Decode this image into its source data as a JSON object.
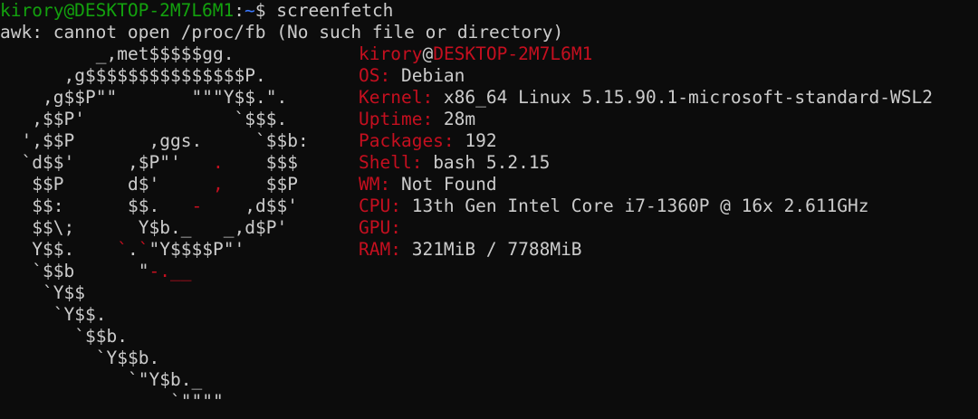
{
  "prompt": {
    "user_host": "kirory@DESKTOP-2M7L6M1",
    "colon": ":",
    "path": "~",
    "dollar": "$",
    "command": "screenfetch"
  },
  "error_line": "awk: cannot open /proc/fb (No such file or directory)",
  "logo_lines": [
    "         _,met$$$$$gg.",
    "      ,g$$$$$$$$$$$$$$$P.",
    "    ,g$$P\"\"       \"\"\"Y$$.\".",
    "   ,$$P'              `$$$.",
    "  ',$$P       ,ggs.     `$$b:",
    "  `d$$'     ,$P\"'   .    $$$",
    "   $$P      d$'     ,    $$P",
    "   $$:      $$.   -    ,d$$'",
    "   $$\\;      Y$b._   _,d$P'",
    "   Y$$.    `.`\"Y$$$$P\"'",
    "   `$$b      \"-.__",
    "    `Y$$",
    "     `Y$$.",
    "       `$$b.",
    "         `Y$$b.",
    "            `\"Y$b._",
    "                `\"\"\"\""
  ],
  "info": {
    "title_user": "kirory",
    "title_at": "@",
    "title_host": "DESKTOP-2M7L6M1",
    "rows": [
      {
        "key": "OS:",
        "value": " Debian"
      },
      {
        "key": "Kernel:",
        "value": " x86_64 Linux 5.15.90.1-microsoft-standard-WSL2"
      },
      {
        "key": "Uptime:",
        "value": " 28m"
      },
      {
        "key": "Packages:",
        "value": " 192"
      },
      {
        "key": "Shell:",
        "value": " bash 5.2.15"
      },
      {
        "key": "WM:",
        "value": " Not Found"
      },
      {
        "key": "CPU:",
        "value": " 13th Gen Intel Core i7-1360P @ 16x 2.611GHz"
      },
      {
        "key": "GPU:",
        "value": ""
      },
      {
        "key": "RAM:",
        "value": " 321MiB / 7788MiB"
      }
    ]
  },
  "colors": {
    "background": "#0c0c0c",
    "foreground": "#cccccc",
    "prompt_user": "#13a10e",
    "prompt_path": "#3b78ff",
    "accent_red": "#c50f1f"
  }
}
